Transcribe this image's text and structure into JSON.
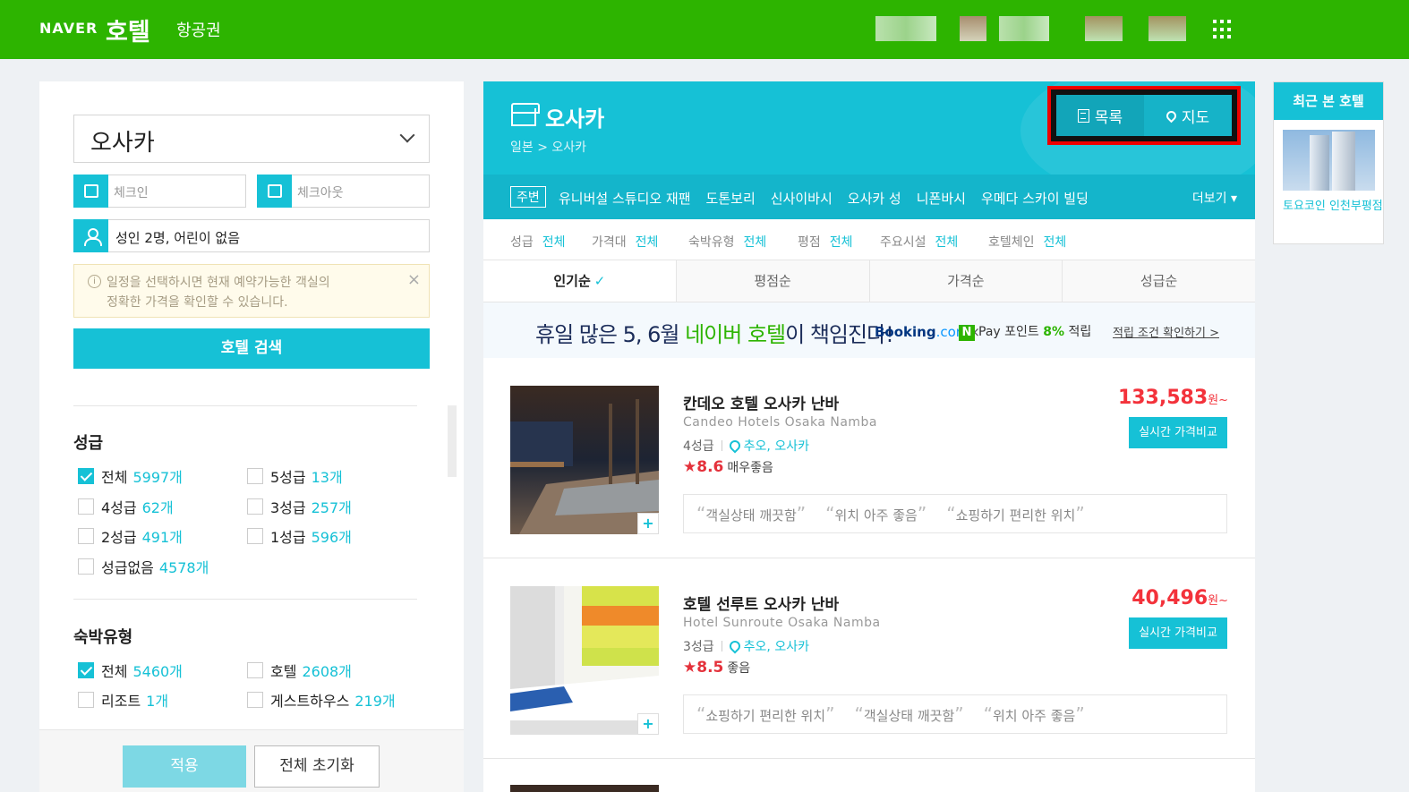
{
  "header": {
    "logo_naver": "NAVER",
    "logo_hotel": "호텔",
    "nav_flight": "항공권"
  },
  "sidebar": {
    "city": "오사카",
    "checkin_placeholder": "체크인",
    "checkout_placeholder": "체크아웃",
    "guests": "성인 2명, 어린이 없음",
    "notice_line1": "일정을 선택하시면 현재 예약가능한 객실의",
    "notice_line2": "정확한 가격을 확인할 수 있습니다.",
    "search_button": "호텔 검색",
    "grade_title": "성급",
    "grades": [
      {
        "label": "전체",
        "count": "5997개",
        "checked": true
      },
      {
        "label": "5성급",
        "count": "13개",
        "checked": false
      },
      {
        "label": "4성급",
        "count": "62개",
        "checked": false
      },
      {
        "label": "3성급",
        "count": "257개",
        "checked": false
      },
      {
        "label": "2성급",
        "count": "491개",
        "checked": false
      },
      {
        "label": "1성급",
        "count": "596개",
        "checked": false
      },
      {
        "label": "성급없음",
        "count": "4578개",
        "checked": false
      }
    ],
    "type_title": "숙박유형",
    "types": [
      {
        "label": "전체",
        "count": "5460개",
        "checked": true
      },
      {
        "label": "호텔",
        "count": "2608개",
        "checked": false
      },
      {
        "label": "리조트",
        "count": "1개",
        "checked": false
      },
      {
        "label": "게스트하우스",
        "count": "219개",
        "checked": false
      }
    ],
    "apply_button": "적용",
    "reset_button": "전체 초기화"
  },
  "main": {
    "city_title": "오사카",
    "breadcrumb": "일본 > 오사카",
    "view_list": "목록",
    "view_map": "지도",
    "nearby_chip": "주변",
    "landmarks": [
      "유니버설 스튜디오 재팬",
      "도톤보리",
      "신사이바시",
      "오사카 성",
      "니폰바시",
      "우메다 스카이 빌딩"
    ],
    "more": "더보기 ▾",
    "filters": [
      {
        "label": "성급",
        "value": "전체"
      },
      {
        "label": "가격대",
        "value": "전체"
      },
      {
        "label": "숙박유형",
        "value": "전체"
      },
      {
        "label": "평점",
        "value": "전체"
      },
      {
        "label": "주요시설",
        "value": "전체"
      },
      {
        "label": "호텔체인",
        "value": "전체"
      }
    ],
    "sort": [
      "인기순",
      "평점순",
      "가격순",
      "성급순"
    ],
    "sort_check": "✓",
    "banner": {
      "text_a": "휴일 많은 5, 6월 ",
      "text_b": "네이버 호텔",
      "text_c": "이 책임진다!",
      "booking_a": "Booking",
      "booking_b": ".com",
      "times": "×",
      "npay_n": "N",
      "npay_a": "Pay 포인트 ",
      "npay_pct": "8%",
      "npay_b": " 적립",
      "condition": "적립 조건 확인하기 >"
    },
    "hotels": [
      {
        "name": "칸데오 호텔 오사카 난바",
        "ename": "Candeo Hotels Osaka Namba",
        "grade": "4성급",
        "location": "추오, 오사카",
        "score": "8.6",
        "score_text": "매우좋음",
        "price": "133,583",
        "price_unit": "원~",
        "compare": "실시간 가격비교",
        "reviews": [
          "객실상태 깨끗함",
          "위치 아주 좋음",
          "쇼핑하기 편리한 위치"
        ]
      },
      {
        "name": "호텔 선루트 오사카 난바",
        "ename": "Hotel Sunroute Osaka Namba",
        "grade": "3성급",
        "location": "추오, 오사카",
        "score": "8.5",
        "score_text": "좋음",
        "price": "40,496",
        "price_unit": "원~",
        "compare": "실시간 가격비교",
        "reviews": [
          "쇼핑하기 편리한 위치",
          "객실상태 깨끗함",
          "위치 아주 좋음"
        ]
      }
    ]
  },
  "recent": {
    "title": "최근 본 호텔",
    "hotel_name": "토요코인 인천부평점"
  },
  "colors": {
    "naver_green": "#2db400",
    "accent": "#16c1d6",
    "price_red": "#f3323b"
  }
}
